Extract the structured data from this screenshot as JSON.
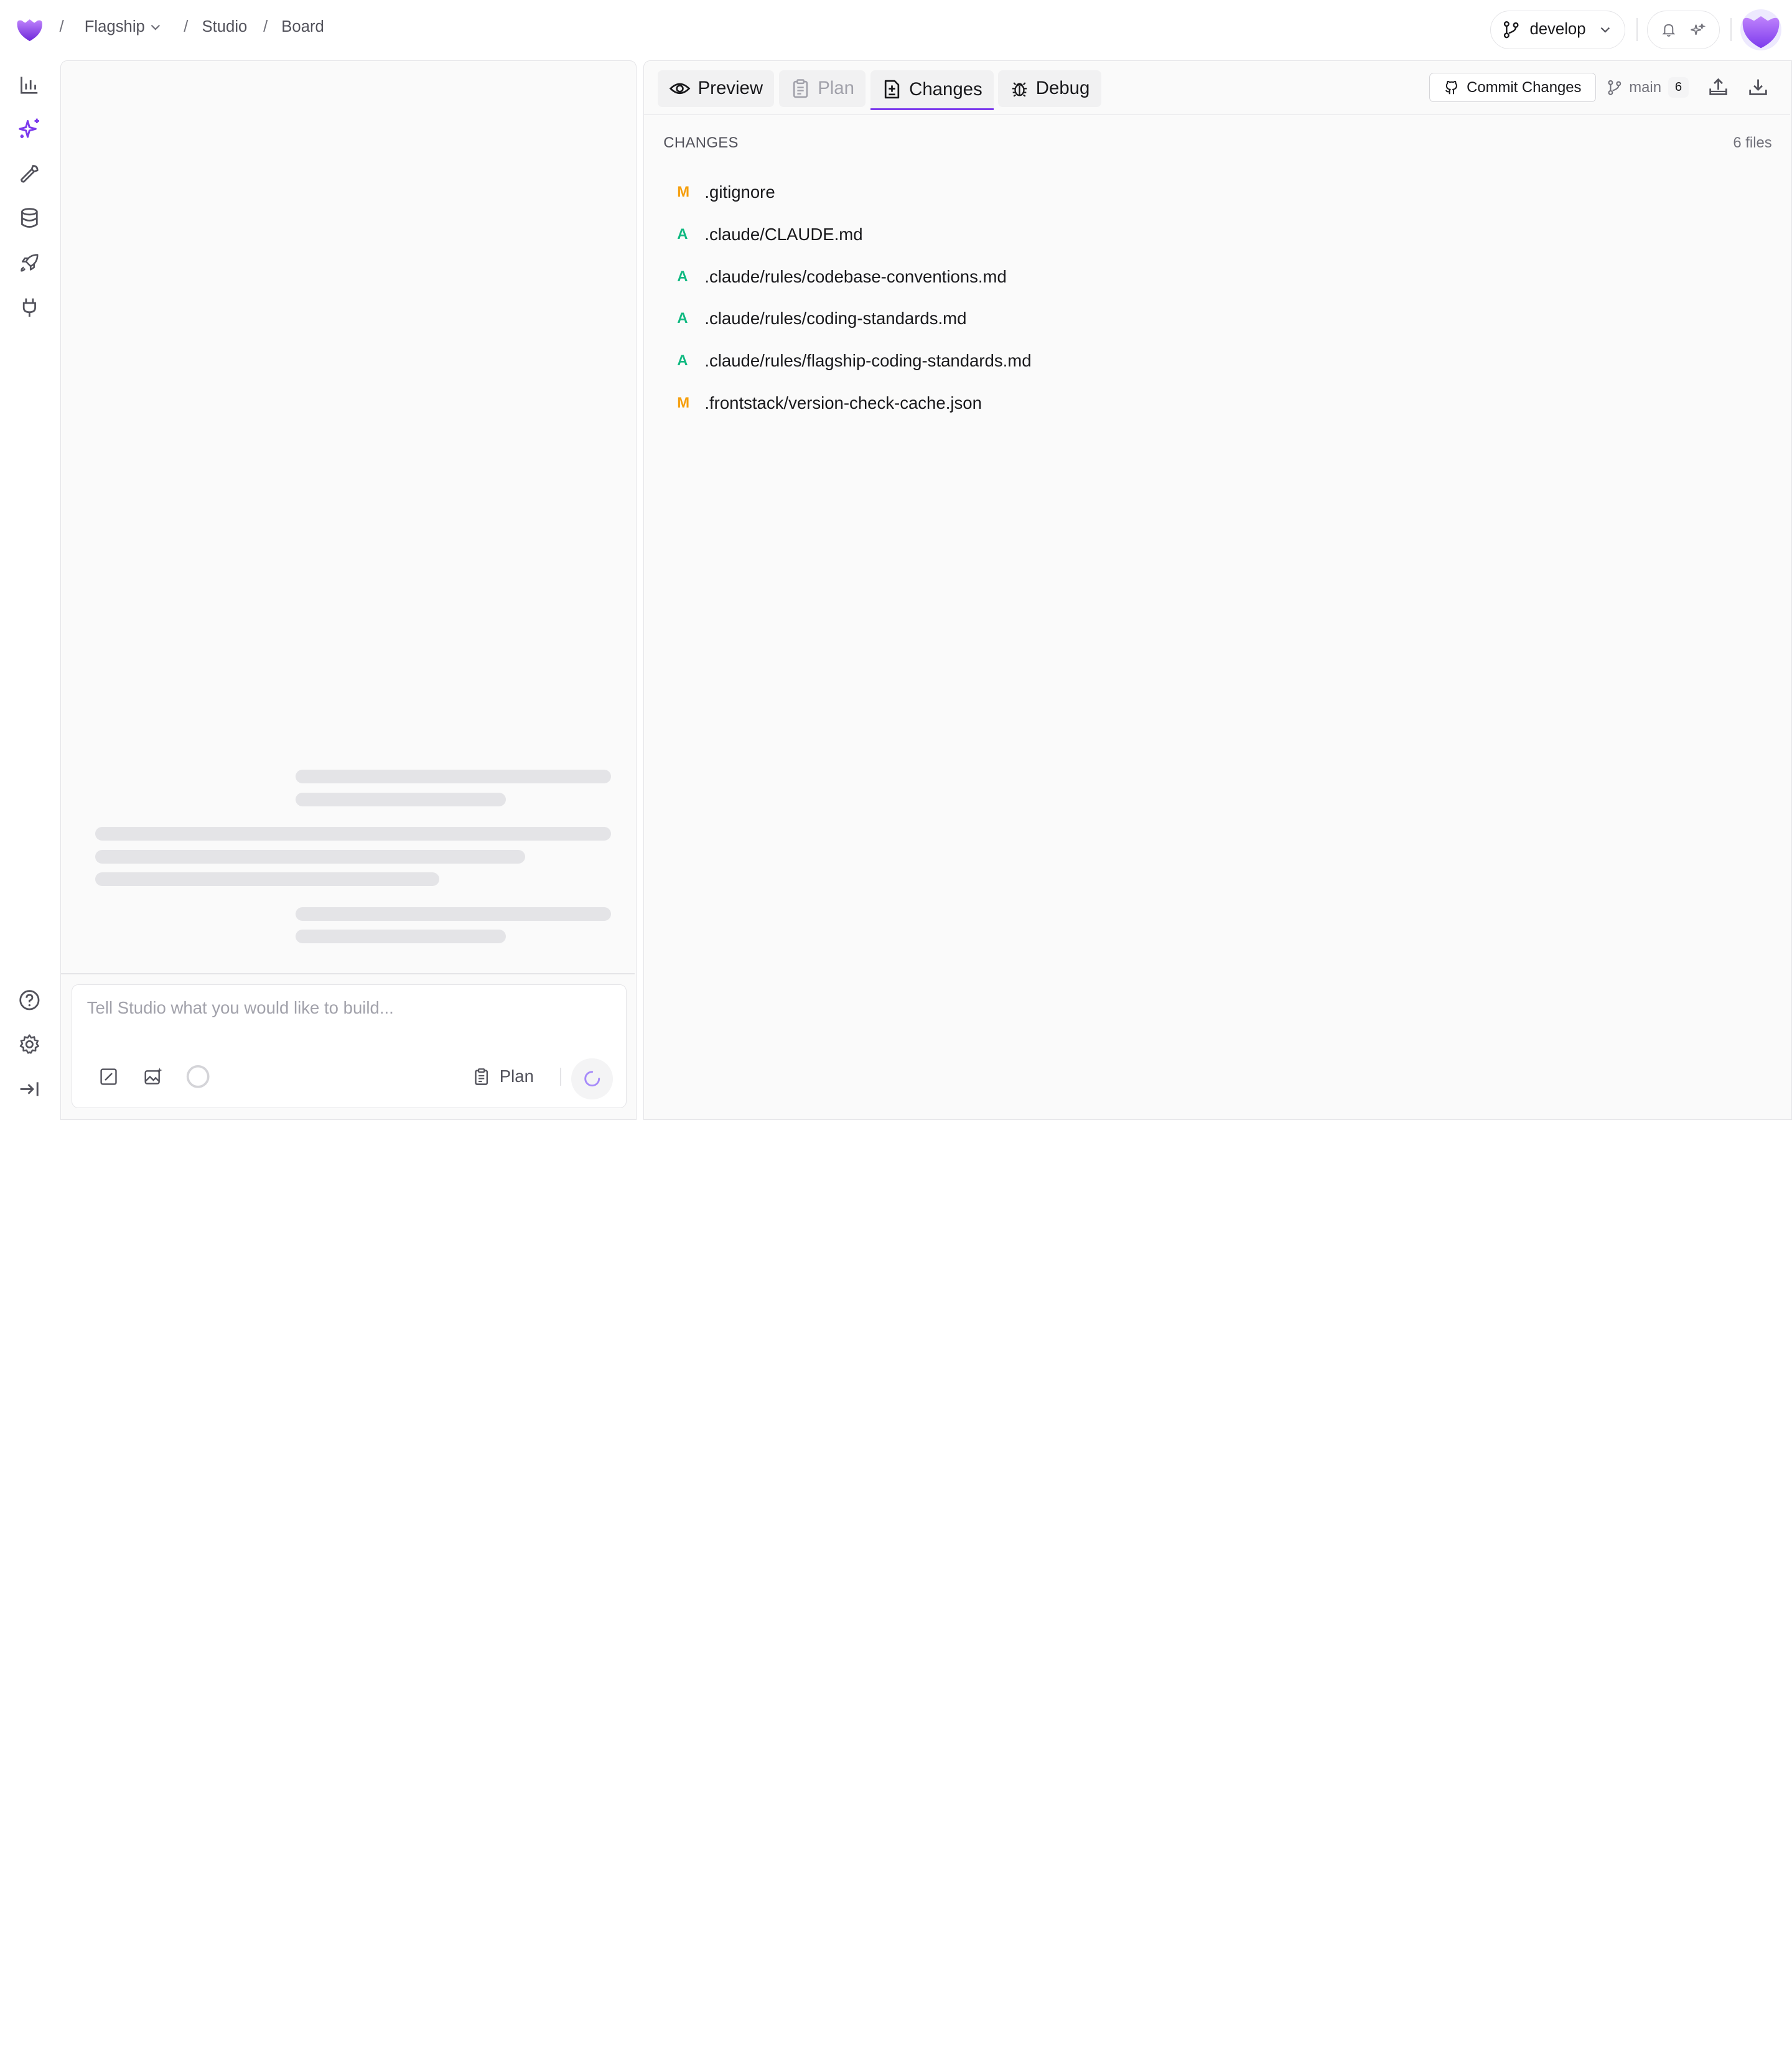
{
  "breadcrumb": {
    "items": [
      "Flagship",
      "Studio",
      "Board"
    ],
    "separator": "/"
  },
  "header": {
    "branch": "develop"
  },
  "chat": {
    "placeholder": "Tell Studio what you would like to build...",
    "plan_label": "Plan"
  },
  "tabs": [
    {
      "label": "Preview",
      "icon": "eye-icon",
      "state": "normal"
    },
    {
      "label": "Plan",
      "icon": "clipboard-icon",
      "state": "disabled"
    },
    {
      "label": "Changes",
      "icon": "file-diff-icon",
      "state": "active"
    },
    {
      "label": "Debug",
      "icon": "bug-icon",
      "state": "normal"
    }
  ],
  "toolbar": {
    "commit_label": "Commit Changes",
    "base_branch": "main",
    "ahead_count": "6"
  },
  "changes": {
    "heading": "CHANGES",
    "count_label": "6 files",
    "files": [
      {
        "status": "M",
        "path": ".gitignore"
      },
      {
        "status": "A",
        "path": ".claude/CLAUDE.md"
      },
      {
        "status": "A",
        "path": ".claude/rules/codebase-conventions.md"
      },
      {
        "status": "A",
        "path": ".claude/rules/coding-standards.md"
      },
      {
        "status": "A",
        "path": ".claude/rules/flagship-coding-standards.md"
      },
      {
        "status": "M",
        "path": ".frontstack/version-check-cache.json"
      }
    ]
  },
  "colors": {
    "accent": "#7c3aed",
    "modified": "#f59e0b",
    "added": "#10b981"
  }
}
